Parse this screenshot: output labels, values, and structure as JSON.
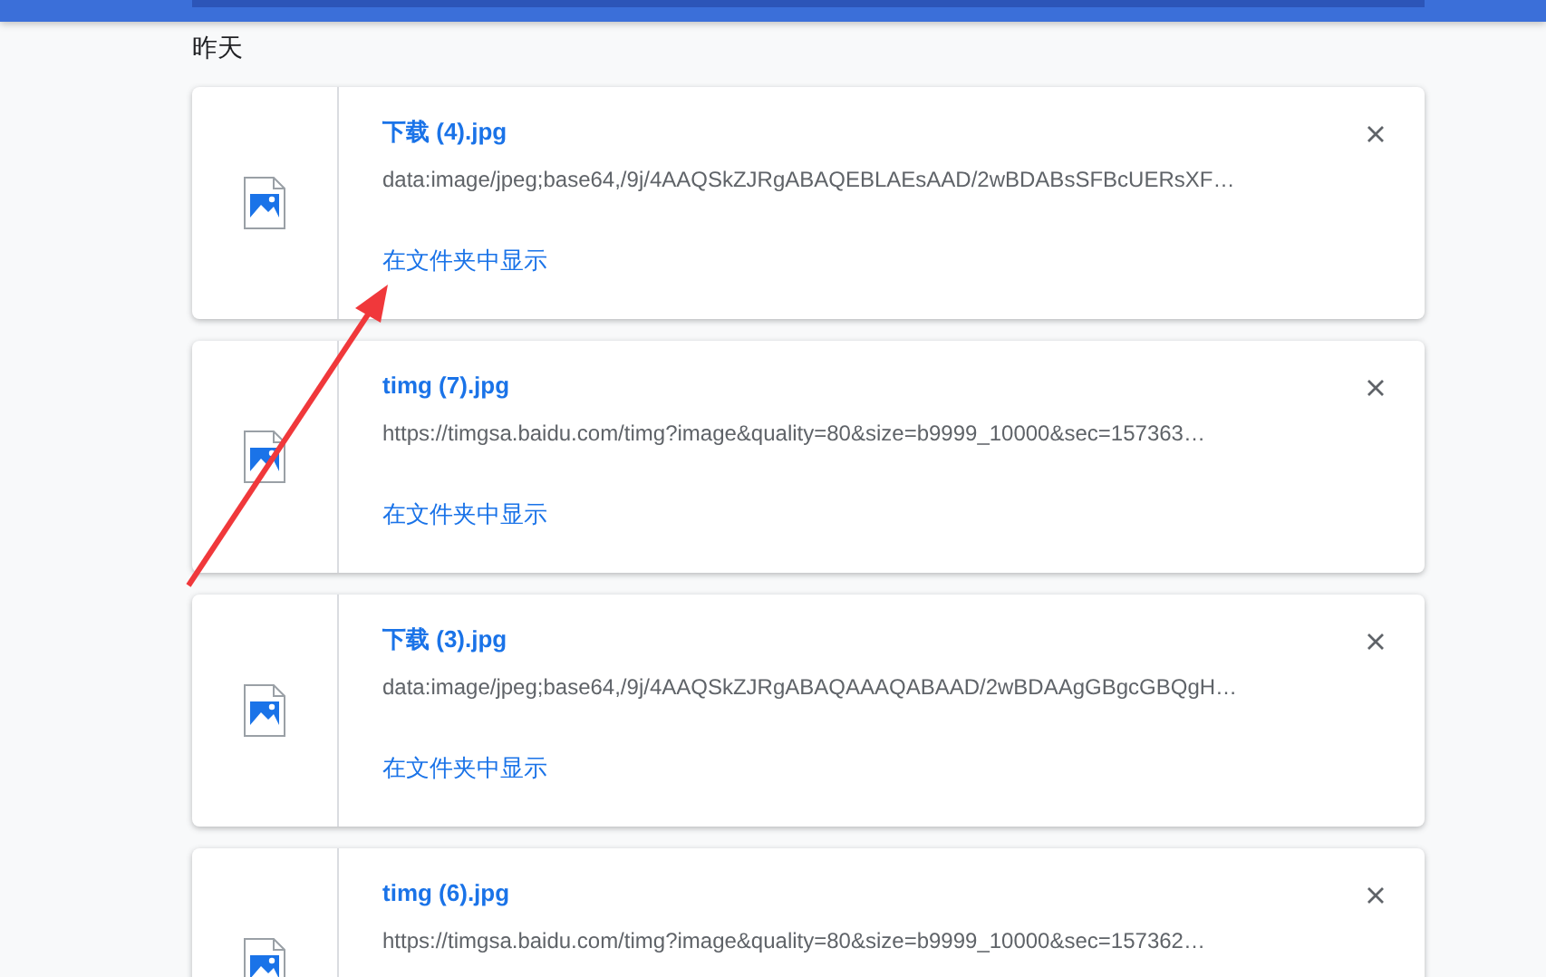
{
  "section": {
    "date_label": "昨天"
  },
  "downloads": [
    {
      "filename": "下载 (4).jpg",
      "url": "data:image/jpeg;base64,/9j/4AAQSkZJRgABAQEBLAEsAAD/2wBDABsSFBcUERsXF…",
      "link": "在文件夹中显示"
    },
    {
      "filename": "timg (7).jpg",
      "url": "https://timgsa.baidu.com/timg?image&quality=80&size=b9999_10000&sec=157363…",
      "link": "在文件夹中显示"
    },
    {
      "filename": "下载 (3).jpg",
      "url": "data:image/jpeg;base64,/9j/4AAQSkZJRgABAQAAAQABAAD/2wBDAAgGBgcGBQgH…",
      "link": "在文件夹中显示"
    },
    {
      "filename": "timg (6).jpg",
      "url": "https://timgsa.baidu.com/timg?image&quality=80&size=b9999_10000&sec=157362…"
    }
  ]
}
